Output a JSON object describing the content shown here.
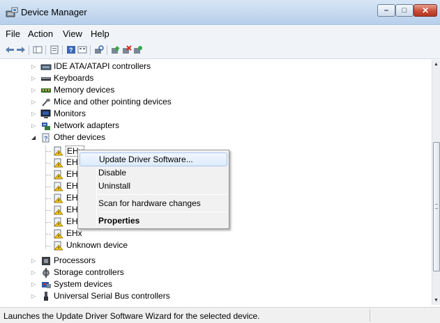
{
  "window": {
    "title": "Device Manager",
    "controls": {
      "minimize": "–",
      "maximize": "□",
      "close": "✕"
    }
  },
  "menubar": {
    "items": [
      "File",
      "Action",
      "View",
      "Help"
    ]
  },
  "toolbar": {
    "icons": [
      "back-icon",
      "forward-icon",
      "show-hide-tree-icon",
      "properties-icon",
      "help-icon",
      "view-icon",
      "scan-hardware-icon",
      "update-driver-icon",
      "uninstall-icon",
      "enable-icon"
    ]
  },
  "tree": {
    "items": [
      {
        "label": "IDE ATA/ATAPI controllers",
        "icon": "ide-controller-icon",
        "expander": "▷"
      },
      {
        "label": "Keyboards",
        "icon": "keyboard-icon",
        "expander": "▷"
      },
      {
        "label": "Memory devices",
        "icon": "memory-icon",
        "expander": "▷"
      },
      {
        "label": "Mice and other pointing devices",
        "icon": "mouse-icon",
        "expander": "▷"
      },
      {
        "label": "Monitors",
        "icon": "monitor-icon",
        "expander": "▷"
      },
      {
        "label": "Network adapters",
        "icon": "network-adapter-icon",
        "expander": "▷"
      },
      {
        "label": "Other devices",
        "icon": "unknown-device-icon",
        "expander": "◢"
      },
      {
        "label": "EHx",
        "icon": "warning-device-icon"
      },
      {
        "label": "EH",
        "icon": "warning-device-icon"
      },
      {
        "label": "EH",
        "icon": "warning-device-icon"
      },
      {
        "label": "EH",
        "icon": "warning-device-icon"
      },
      {
        "label": "EH",
        "icon": "warning-device-icon"
      },
      {
        "label": "EH",
        "icon": "warning-device-icon"
      },
      {
        "label": "EH",
        "icon": "warning-device-icon"
      },
      {
        "label": "EHx",
        "icon": "warning-device-icon"
      },
      {
        "label": "Unknown device",
        "icon": "warning-device-icon"
      },
      {
        "label": "Processors",
        "icon": "processor-icon",
        "expander": "▷"
      },
      {
        "label": "Storage controllers",
        "icon": "storage-controller-icon",
        "expander": "▷"
      },
      {
        "label": "System devices",
        "icon": "system-devices-icon",
        "expander": "▷"
      },
      {
        "label": "Universal Serial Bus controllers",
        "icon": "usb-icon",
        "expander": "▷"
      }
    ]
  },
  "context_menu": {
    "items": [
      {
        "label": "Update Driver Software...",
        "highlighted": true
      },
      {
        "label": "Disable"
      },
      {
        "label": "Uninstall"
      },
      {
        "label": "Scan for hardware changes"
      },
      {
        "label": "Properties",
        "bold": true
      }
    ]
  },
  "scrollbar": {
    "up": "▲",
    "down": "▼"
  },
  "statusbar": {
    "text": "Launches the Update Driver Software Wizard for the selected device."
  }
}
